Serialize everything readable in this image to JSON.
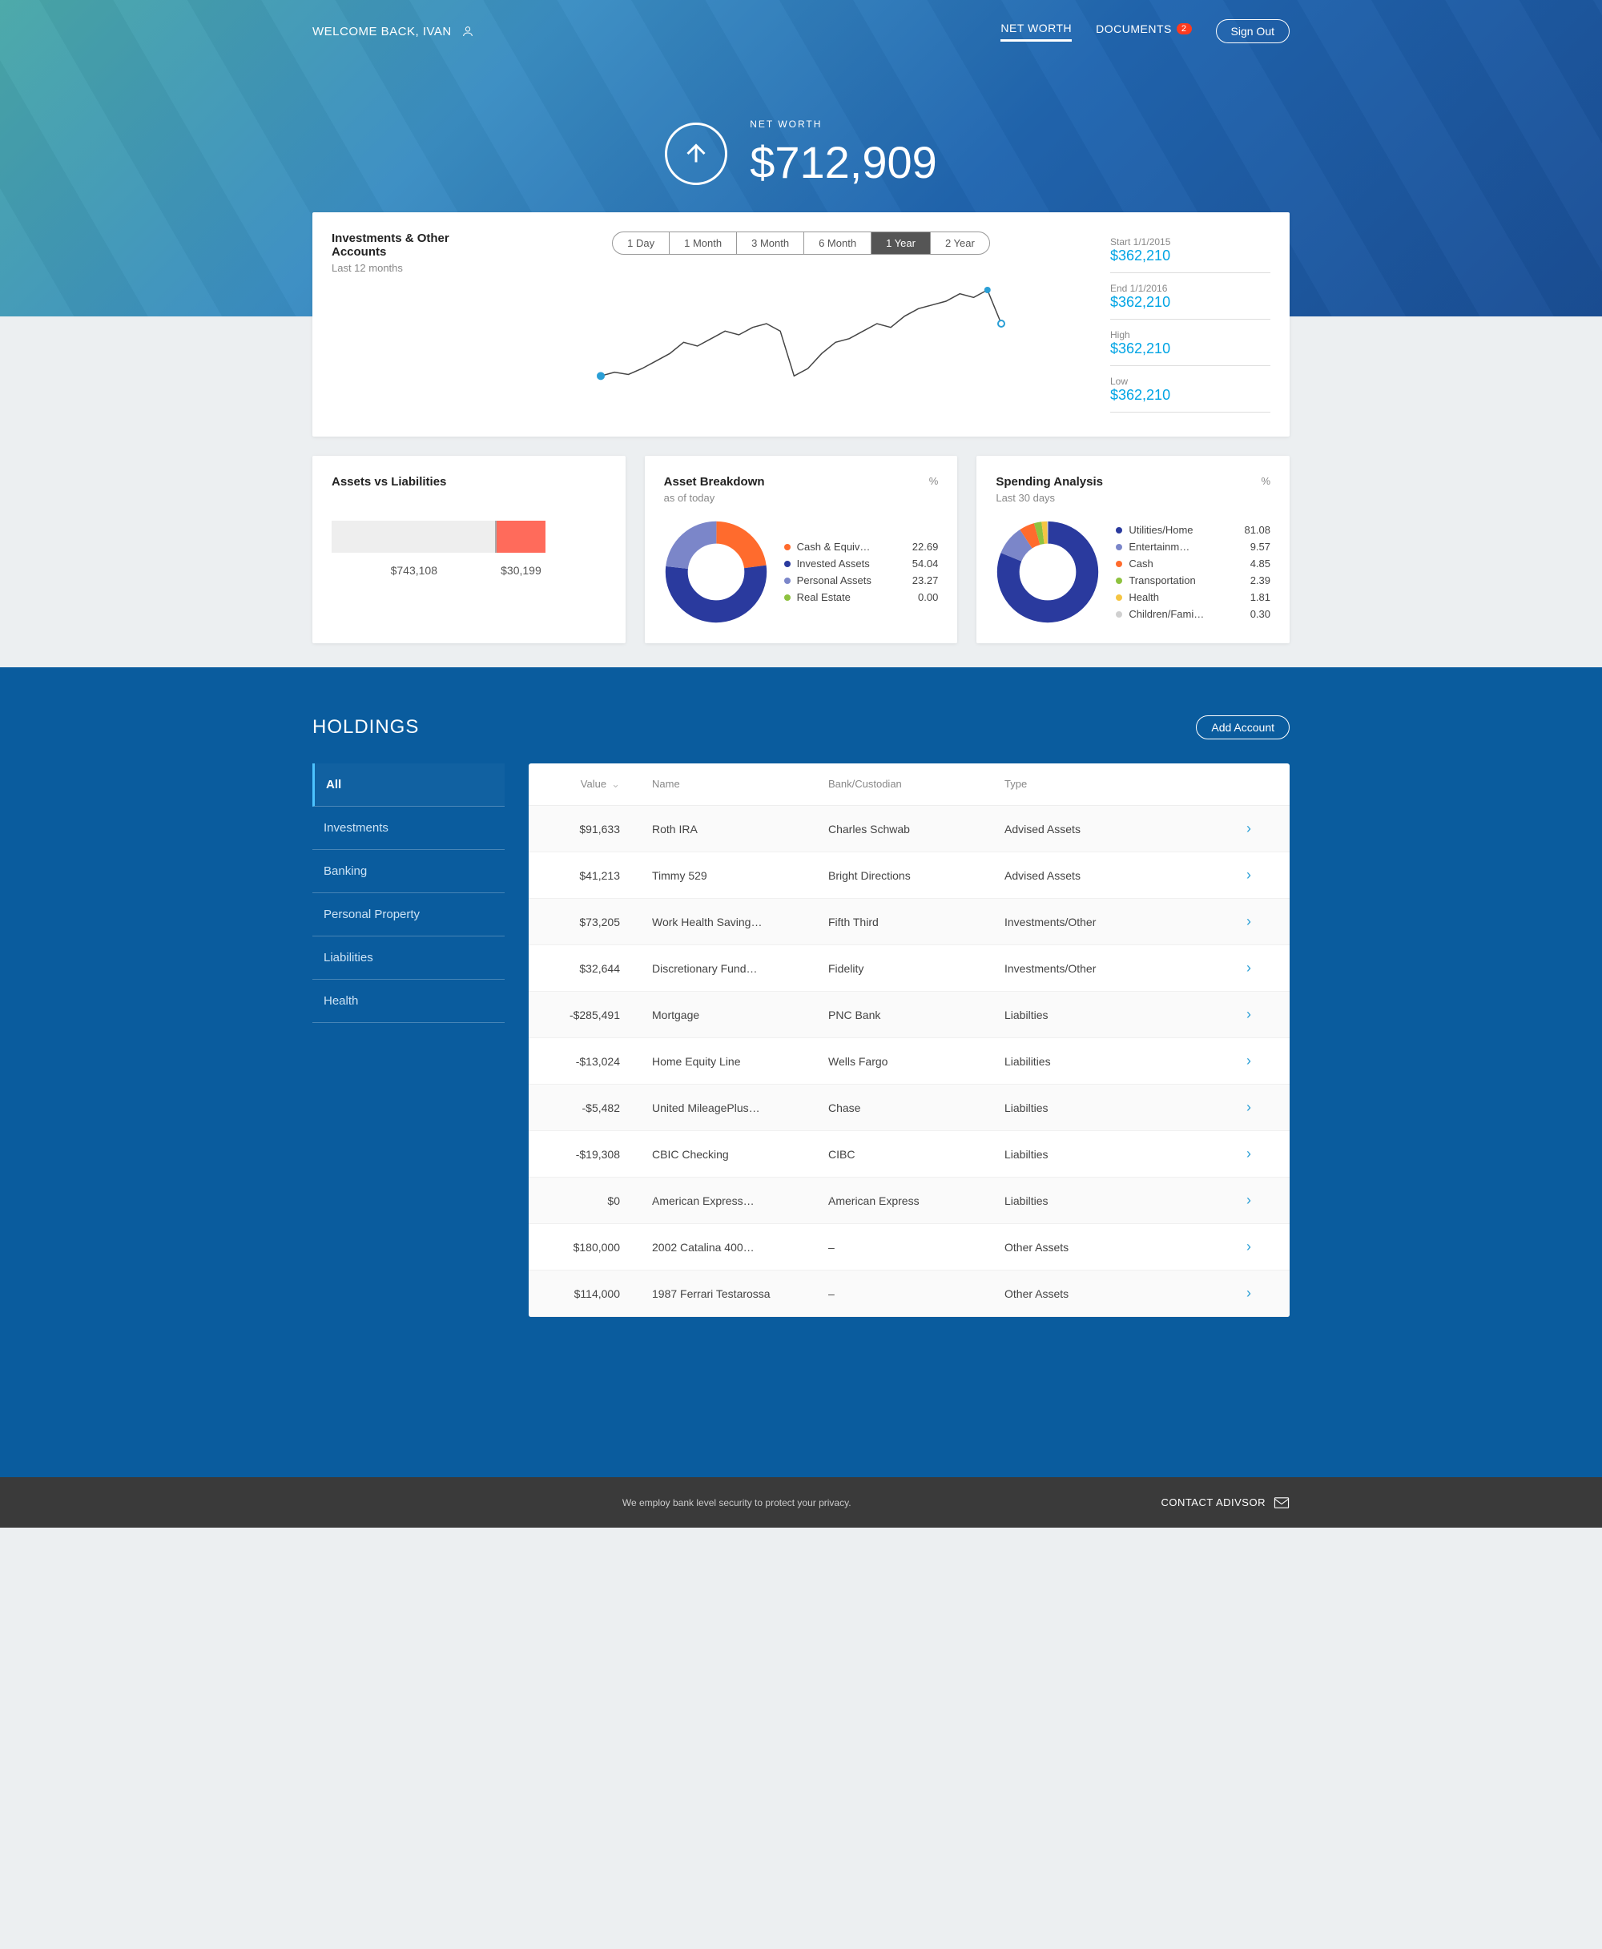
{
  "header": {
    "welcome": "WELCOME BACK, IVAN",
    "nav": {
      "networth": "NET WORTH",
      "documents": "DOCUMENTS",
      "doc_badge": "2",
      "signout": "Sign Out"
    }
  },
  "networth": {
    "label": "NET WORTH",
    "value": "$712,909"
  },
  "investments_chart": {
    "title": "Investments & Other Accounts",
    "subtitle": "Last 12 months",
    "ranges": [
      "1 Day",
      "1 Month",
      "3 Month",
      "6 Month",
      "1 Year",
      "2 Year"
    ],
    "active_range": "1 Year",
    "stats": {
      "start_label": "Start 1/1/2015",
      "start_value": "$362,210",
      "end_label": "End 1/1/2016",
      "end_value": "$362,210",
      "high_label": "High",
      "high_value": "$362,210",
      "low_label": "Low",
      "low_value": "$362,210"
    }
  },
  "assets_vs_liabilities": {
    "title": "Assets vs Liabilities",
    "assets": "$743,108",
    "liabilities": "$30,199"
  },
  "asset_breakdown": {
    "title": "Asset Breakdown",
    "subtitle": "as of today",
    "items": [
      {
        "label": "Cash & Equiv…",
        "value": "22.69",
        "color": "#ff6b2d"
      },
      {
        "label": "Invested Assets",
        "value": "54.04",
        "color": "#2a3a9e"
      },
      {
        "label": "Personal Assets",
        "value": "23.27",
        "color": "#7b86c9"
      },
      {
        "label": "Real Estate",
        "value": "0.00",
        "color": "#8ec23f"
      }
    ]
  },
  "spending": {
    "title": "Spending Analysis",
    "subtitle": "Last 30 days",
    "items": [
      {
        "label": "Utilities/Home",
        "value": "81.08",
        "color": "#2a3a9e"
      },
      {
        "label": "Entertainm…",
        "value": "9.57",
        "color": "#7b86c9"
      },
      {
        "label": "Cash",
        "value": "4.85",
        "color": "#ff6b2d"
      },
      {
        "label": "Transportation",
        "value": "2.39",
        "color": "#8ec23f"
      },
      {
        "label": "Health",
        "value": "1.81",
        "color": "#f5c542"
      },
      {
        "label": "Children/Fami…",
        "value": "0.30",
        "color": "#d0d0d0"
      }
    ]
  },
  "holdings": {
    "title": "HOLDINGS",
    "add_button": "Add Account",
    "tabs": [
      "All",
      "Investments",
      "Banking",
      "Personal Property",
      "Liabilities",
      "Health"
    ],
    "columns": {
      "value": "Value",
      "name": "Name",
      "bank": "Bank/Custodian",
      "type": "Type"
    },
    "rows": [
      {
        "value": "$91,633",
        "name": "Roth IRA",
        "bank": "Charles Schwab",
        "type": "Advised Assets"
      },
      {
        "value": "$41,213",
        "name": "Timmy 529",
        "bank": "Bright Directions",
        "type": "Advised Assets"
      },
      {
        "value": "$73,205",
        "name": "Work Health Saving…",
        "bank": "Fifth Third",
        "type": "Investments/Other"
      },
      {
        "value": "$32,644",
        "name": "Discretionary Fund…",
        "bank": "Fidelity",
        "type": "Investments/Other"
      },
      {
        "value": "-$285,491",
        "name": "Mortgage",
        "bank": "PNC Bank",
        "type": "Liabilties"
      },
      {
        "value": "-$13,024",
        "name": "Home Equity Line",
        "bank": "Wells Fargo",
        "type": "Liabilities"
      },
      {
        "value": "-$5,482",
        "name": "United MileagePlus…",
        "bank": "Chase",
        "type": "Liabilties"
      },
      {
        "value": "-$19,308",
        "name": "CBIC Checking",
        "bank": "CIBC",
        "type": "Liabilties"
      },
      {
        "value": "$0",
        "name": "American Express…",
        "bank": "American Express",
        "type": "Liabilties"
      },
      {
        "value": "$180,000",
        "name": "2002 Catalina 400…",
        "bank": "–",
        "type": "Other Assets"
      },
      {
        "value": "$114,000",
        "name": "1987 Ferrari Testarossa",
        "bank": "–",
        "type": "Other Assets"
      }
    ]
  },
  "footer": {
    "security": "We employ bank level security to protect your privacy.",
    "contact": "CONTACT ADIVSOR"
  },
  "chart_data": [
    {
      "type": "line",
      "title": "Investments & Other Accounts – Last 12 months",
      "x": [
        0,
        1,
        2,
        3,
        4,
        5,
        6,
        7,
        8,
        9,
        10,
        11,
        12,
        13,
        14,
        15,
        16,
        17,
        18,
        19,
        20,
        21,
        22,
        23,
        24,
        25,
        26,
        27,
        28,
        29
      ],
      "values": [
        300000,
        305000,
        302000,
        310000,
        320000,
        330000,
        345000,
        340000,
        350000,
        360000,
        355000,
        365000,
        370000,
        360000,
        300000,
        310000,
        330000,
        345000,
        350000,
        360000,
        370000,
        365000,
        380000,
        390000,
        395000,
        400000,
        410000,
        405000,
        415000,
        370000
      ],
      "ylim": [
        280000,
        430000
      ]
    },
    {
      "type": "bar",
      "title": "Assets vs Liabilities",
      "categories": [
        "Assets",
        "Liabilities"
      ],
      "values": [
        743108,
        30199
      ]
    },
    {
      "type": "pie",
      "title": "Asset Breakdown (%)",
      "categories": [
        "Cash & Equivalents",
        "Invested Assets",
        "Personal Assets",
        "Real Estate"
      ],
      "values": [
        22.69,
        54.04,
        23.27,
        0.0
      ]
    },
    {
      "type": "pie",
      "title": "Spending Analysis last 30 days (%)",
      "categories": [
        "Utilities/Home",
        "Entertainment",
        "Cash",
        "Transportation",
        "Health",
        "Children/Family"
      ],
      "values": [
        81.08,
        9.57,
        4.85,
        2.39,
        1.81,
        0.3
      ]
    }
  ]
}
